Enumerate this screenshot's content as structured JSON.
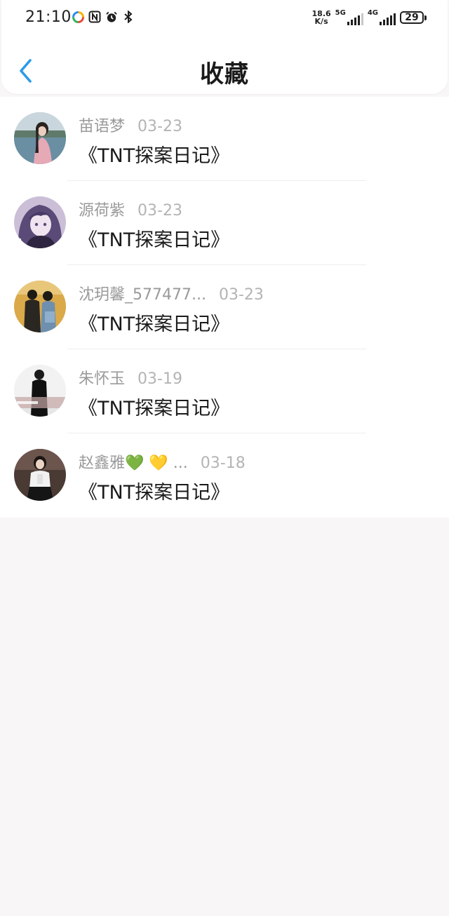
{
  "status_bar": {
    "time": "21:10",
    "net_speed_value": "18.6",
    "net_speed_unit": "K/s",
    "sim1_label": "5G",
    "sim2_label": "4G",
    "battery_level": "29",
    "left_icons": [
      "app-notification-icon",
      "nfc-icon",
      "alarm-icon",
      "bluetooth-icon"
    ]
  },
  "header": {
    "title": "收藏",
    "back_icon": "chevron-left-icon",
    "accent_color": "#2b9bea"
  },
  "favorites": [
    {
      "name": "苗语梦",
      "date": "03-23",
      "title": "《TNT探案日记》"
    },
    {
      "name": "源荷紫",
      "date": "03-23",
      "title": "《TNT探案日记》"
    },
    {
      "name": "沈玥馨_577477...",
      "date": "03-23",
      "title": "《TNT探案日记》"
    },
    {
      "name": "朱怀玉",
      "date": "03-19",
      "title": "《TNT探案日记》"
    },
    {
      "name": "赵鑫雅💚 💛 ...",
      "date": "03-18",
      "title": "《TNT探案日记》"
    }
  ]
}
